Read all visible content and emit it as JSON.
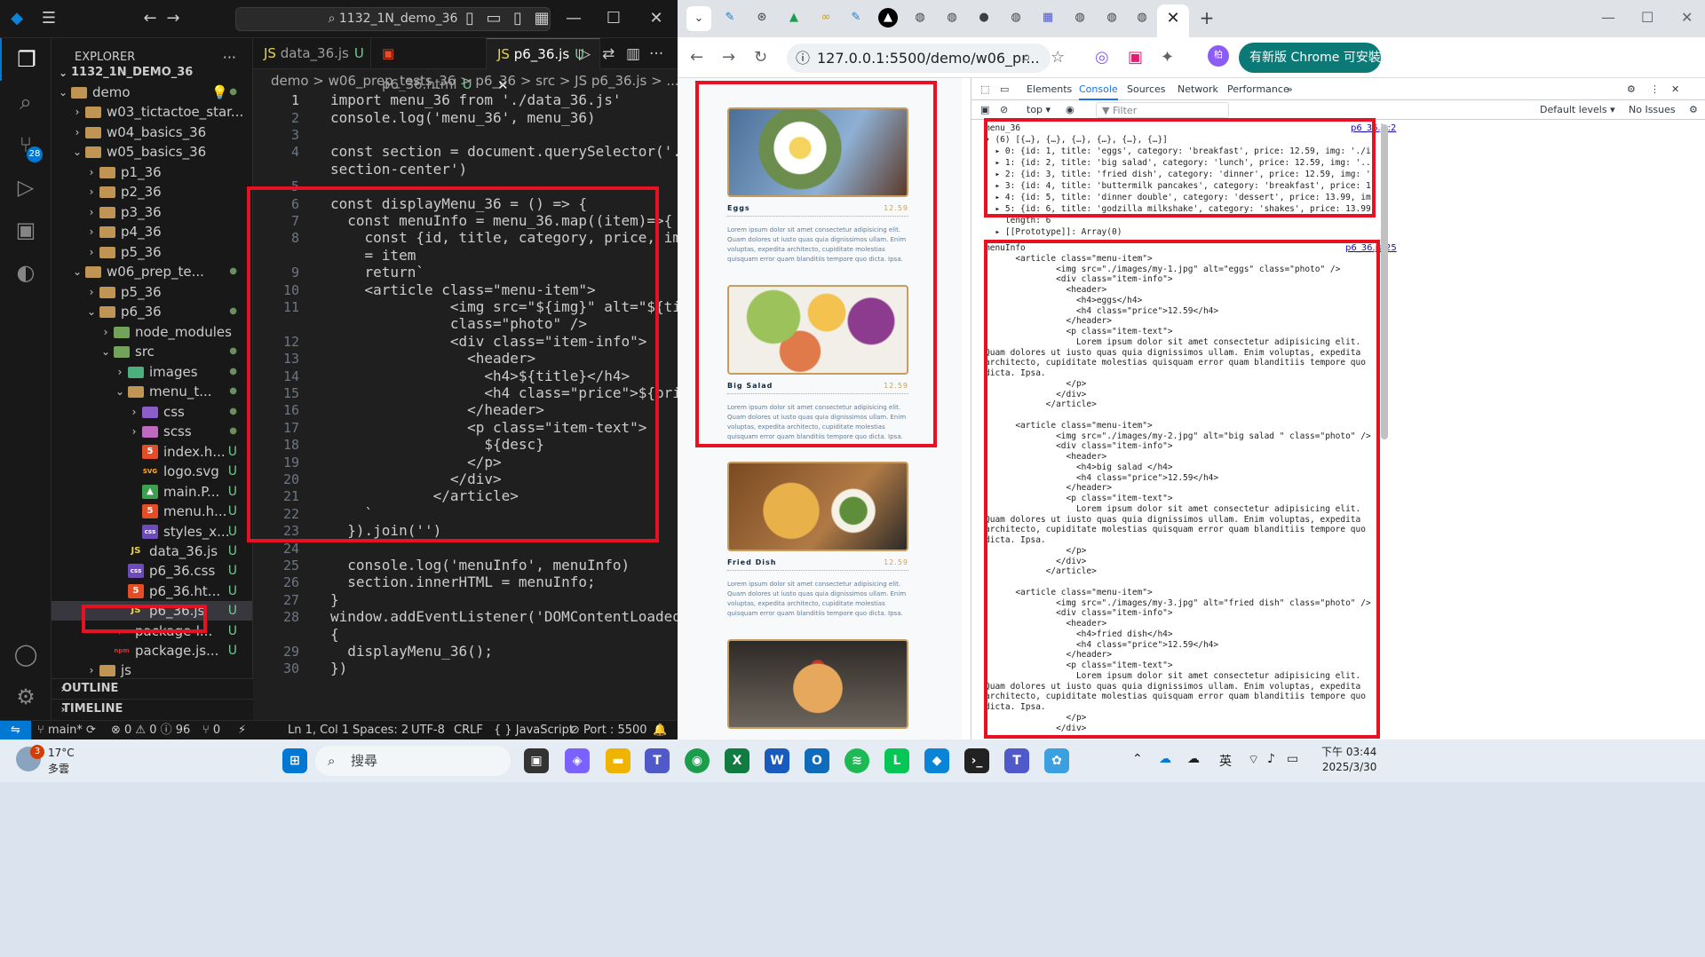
{
  "vscode": {
    "search_text": "1132_1N_demo_36",
    "explorer_title": "EXPLORER",
    "root_folder": "1132_1N_DEMO_36",
    "scm_badge": "28",
    "tree": [
      {
        "label": "demo",
        "status": "●"
      },
      {
        "label": "w03_tictactoe_star...",
        "status": ""
      },
      {
        "label": "w04_basics_36",
        "status": ""
      },
      {
        "label": "w05_basics_36",
        "status": ""
      },
      {
        "label": "p1_36",
        "status": ""
      },
      {
        "label": "p2_36",
        "status": ""
      },
      {
        "label": "p3_36",
        "status": ""
      },
      {
        "label": "p4_36",
        "status": ""
      },
      {
        "label": "p5_36",
        "status": ""
      },
      {
        "label": "w06_prep_te...",
        "status": "●"
      },
      {
        "label": "p5_36",
        "status": ""
      },
      {
        "label": "p6_36",
        "status": "●"
      },
      {
        "label": "node_modules",
        "status": ""
      },
      {
        "label": "src",
        "status": "●"
      },
      {
        "label": "images",
        "status": "●"
      },
      {
        "label": "menu_t...",
        "status": "●"
      },
      {
        "label": "css",
        "status": "●"
      },
      {
        "label": "scss",
        "status": "●"
      },
      {
        "label": "index.h...",
        "status": "U"
      },
      {
        "label": "logo.svg",
        "status": "U"
      },
      {
        "label": "main.P...",
        "status": "U"
      },
      {
        "label": "menu.h...",
        "status": "U"
      },
      {
        "label": "styles_x...",
        "status": "U"
      },
      {
        "label": "data_36.js",
        "status": "U"
      },
      {
        "label": "p6_36.css",
        "status": "U"
      },
      {
        "label": "p6_36.ht...",
        "status": "U"
      },
      {
        "label": "p6_36.js",
        "status": "U"
      },
      {
        "label": "package-l...",
        "status": "U"
      },
      {
        "label": "package.js...",
        "status": "U"
      },
      {
        "label": "js",
        "status": ""
      }
    ],
    "outline_label": "OUTLINE",
    "timeline_label": "TIMELINE",
    "tabs": [
      {
        "label": "data_36.js",
        "mod": "U"
      },
      {
        "label": "p6_36.html",
        "mod": "U"
      },
      {
        "label": "p6_36.js",
        "mod": "U"
      }
    ],
    "breadcrumb": "demo  >  w06_prep_tests_36  >  p6_36  >  src  >  JS  p6_36.js  >  ...",
    "code_lines": [
      {
        "n": "1",
        "t": "import menu_36 from './data_36.js'"
      },
      {
        "n": "2",
        "t": "console.log('menu_36', menu_36)"
      },
      {
        "n": "3",
        "t": ""
      },
      {
        "n": "4",
        "t": "const section = document.querySelector('."
      },
      {
        "n": "",
        "t": "section-center')"
      },
      {
        "n": "5",
        "t": ""
      },
      {
        "n": "6",
        "t": "const displayMenu_36 = () => {"
      },
      {
        "n": "7",
        "t": "  const menuInfo = menu_36.map((item)=>{"
      },
      {
        "n": "8",
        "t": "    const {id, title, category, price, img, desc}"
      },
      {
        "n": "",
        "t": "    = item"
      },
      {
        "n": "9",
        "t": "    return`"
      },
      {
        "n": "10",
        "t": "    <article class=\"menu-item\">"
      },
      {
        "n": "11",
        "t": "              <img src=\"${img}\" alt=\"${title}\""
      },
      {
        "n": "",
        "t": "              class=\"photo\" />"
      },
      {
        "n": "12",
        "t": "              <div class=\"item-info\">"
      },
      {
        "n": "13",
        "t": "                <header>"
      },
      {
        "n": "14",
        "t": "                  <h4>${title}</h4>"
      },
      {
        "n": "15",
        "t": "                  <h4 class=\"price\">${price}</h4>"
      },
      {
        "n": "16",
        "t": "                </header>"
      },
      {
        "n": "17",
        "t": "                <p class=\"item-text\">"
      },
      {
        "n": "18",
        "t": "                  ${desc}"
      },
      {
        "n": "19",
        "t": "                </p>"
      },
      {
        "n": "20",
        "t": "              </div>"
      },
      {
        "n": "21",
        "t": "            </article>"
      },
      {
        "n": "22",
        "t": "    `"
      },
      {
        "n": "23",
        "t": "  }).join('')"
      },
      {
        "n": "24",
        "t": ""
      },
      {
        "n": "25",
        "t": "  console.log('menuInfo', menuInfo)"
      },
      {
        "n": "26",
        "t": "  section.innerHTML = menuInfo;"
      },
      {
        "n": "27",
        "t": "}"
      },
      {
        "n": "28",
        "t": "window.addEventListener('DOMContentLoaded', () =>"
      },
      {
        "n": "",
        "t": "{"
      },
      {
        "n": "29",
        "t": "  displayMenu_36();"
      },
      {
        "n": "30",
        "t": "})"
      }
    ],
    "status": {
      "branch": "main*",
      "problems": "⊗ 0 ⚠ 0 ⓘ 96",
      "ports": "⑂ 0",
      "position": "Ln 1, Col 1",
      "spaces": "Spaces: 2",
      "encoding": "UTF-8",
      "eol": "CRLF",
      "language": "{ } JavaScript",
      "port": "⊘ Port : 5500"
    }
  },
  "chrome": {
    "url": "127.0.0.1:5500/demo/w06_pr...",
    "update_label": "有新版 Chrome 可安裝",
    "menu_items": [
      {
        "title": "Eggs",
        "price": "12.59",
        "desc": "Lorem ipsum dolor sit amet consectetur adipisicing elit. Quam dolores ut iusto quas quia dignissimos ullam. Enim voluptas, expedita architecto, cupiditate molestias quisquam error quam blanditiis tempore quo dicta. Ipsa."
      },
      {
        "title": "Big Salad",
        "price": "12.59",
        "desc": "Lorem ipsum dolor sit amet consectetur adipisicing elit. Quam dolores ut iusto quas quia dignissimos ullam. Enim voluptas, expedita architecto, cupiditate molestias quisquam error quam blanditiis tempore quo dicta. Ipsa."
      },
      {
        "title": "Fried Dish",
        "price": "12.59",
        "desc": "Lorem ipsum dolor sit amet consectetur adipisicing elit. Quam dolores ut iusto quas quia dignissimos ullam. Enim voluptas, expedita architecto, cupiditate molestias quisquam error quam blanditiis tempore quo dicta. Ipsa."
      },
      {
        "title": "",
        "price": "",
        "desc": ""
      }
    ],
    "devtools": {
      "tabs": [
        "Elements",
        "Console",
        "Sources",
        "Network",
        "Performance",
        "»"
      ],
      "context": "top ▾",
      "filter": "Filter",
      "levels": "Default levels ▾",
      "issues": "No Issues",
      "src1": "p6_36.js:2",
      "src2": "p6_36.js:25",
      "console_lines_1": [
        "menu_36",
        "▾ (6) [{…}, {…}, {…}, {…}, {…}, {…}]",
        "  ▸ 0: {id: 1, title: 'eggs', category: 'breakfast', price: 12.59, img: './i",
        "  ▸ 1: {id: 2, title: 'big salad', category: 'lunch', price: 12.59, img: '..",
        "  ▸ 2: {id: 3, title: 'fried dish', category: 'dinner', price: 12.59, img: '",
        "  ▸ 3: {id: 4, title: 'buttermilk pancakes', category: 'breakfast', price: 1!",
        "  ▸ 4: {id: 5, title: 'dinner double', category: 'dessert', price: 13.99, im",
        "  ▸ 5: {id: 6, title: 'godzilla milkshake', category: 'shakes', price: 13.99",
        "    length: 6",
        "  ▸ [[Prototype]]: Array(0)"
      ],
      "console_lines_2": [
        "menuInfo",
        "      <article class=\"menu-item\">",
        "              <img src=\"./images/my-1.jpg\" alt=\"eggs\" class=\"photo\" />",
        "              <div class=\"item-info\">",
        "                <header>",
        "                  <h4>eggs</h4>",
        "                  <h4 class=\"price\">12.59</h4>",
        "                </header>",
        "                <p class=\"item-text\">",
        "                  Lorem ipsum dolor sit amet consectetur adipisicing elit.",
        "Quam dolores ut iusto quas quia dignissimos ullam. Enim voluptas, expedita",
        "architecto, cupiditate molestias quisquam error quam blanditiis tempore quo",
        "dicta. Ipsa.",
        "                </p>",
        "              </div>",
        "            </article>",
        "",
        "      <article class=\"menu-item\">",
        "              <img src=\"./images/my-2.jpg\" alt=\"big salad \" class=\"photo\" />",
        "              <div class=\"item-info\">",
        "                <header>",
        "                  <h4>big salad </h4>",
        "                  <h4 class=\"price\">12.59</h4>",
        "                </header>",
        "                <p class=\"item-text\">",
        "                  Lorem ipsum dolor sit amet consectetur adipisicing elit.",
        "Quam dolores ut iusto quas quia dignissimos ullam. Enim voluptas, expedita",
        "architecto, cupiditate molestias quisquam error quam blanditiis tempore quo",
        "dicta. Ipsa.",
        "                </p>",
        "              </div>",
        "            </article>",
        "",
        "      <article class=\"menu-item\">",
        "              <img src=\"./images/my-3.jpg\" alt=\"fried dish\" class=\"photo\" />",
        "              <div class=\"item-info\">",
        "                <header>",
        "                  <h4>fried dish</h4>",
        "                  <h4 class=\"price\">12.59</h4>",
        "                </header>",
        "                <p class=\"item-text\">",
        "                  Lorem ipsum dolor sit amet consectetur adipisicing elit.",
        "Quam dolores ut iusto quas quia dignissimos ullam. Enim voluptas, expedita",
        "architecto, cupiditate molestias quisquam error quam blanditiis tempore quo",
        "dicta. Ipsa.",
        "                </p>",
        "              </div>"
      ]
    }
  },
  "taskbar": {
    "temp": "17°C",
    "weather": "多雲",
    "weather_badge": "3",
    "search": "搜尋",
    "ime": "英",
    "time": "下午 03:44",
    "date": "2025/3/30"
  },
  "colors": {
    "highlight": "#e81123",
    "accent": "#0078d4"
  }
}
